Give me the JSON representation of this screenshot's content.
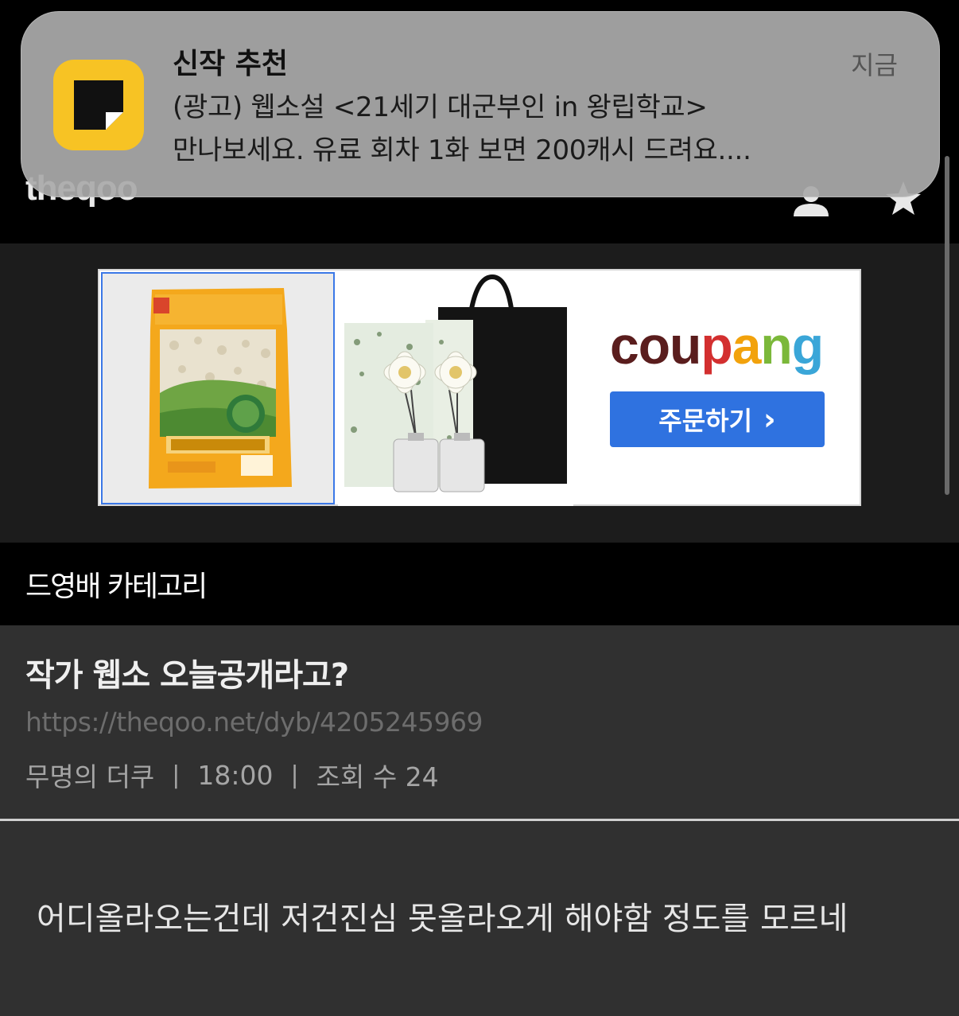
{
  "notification": {
    "title": "신작 추천",
    "line1": "(광고) 웹소설 <21세기 대군부인 in 왕립학교>",
    "line2": "만나보세요. 유료 회차 1화 보면 200캐시 드려요....",
    "time": "지금",
    "app_icon": "page-app-icon",
    "icon_color": "#f7c324"
  },
  "header": {
    "logo": "theqoo",
    "user_icon": "user-icon",
    "star_icon": "star-icon"
  },
  "ad": {
    "brand_letters": [
      "c",
      "o",
      "u",
      "p",
      "a",
      "n",
      "g"
    ],
    "brand_colors": [
      "#5a1d1d",
      "#5a1d1d",
      "#5a1d1d",
      "#d32f2f",
      "#f2a20c",
      "#7bb83a",
      "#3aa6d8"
    ],
    "order_label": "주문하기",
    "order_arrow": "›",
    "button_color": "#2f72e0"
  },
  "category": {
    "name": "드영배 카테고리"
  },
  "article": {
    "title": "작가 웹소 오늘공개라고?",
    "url": "https://theqoo.net/dyb/4205245969",
    "author": "무명의 더쿠",
    "time": "18:00",
    "views": "조회 수 24",
    "separator": "|",
    "body": "어디올라오는건데 저건진심 못올라오게 해야함 정도를 모르네"
  }
}
